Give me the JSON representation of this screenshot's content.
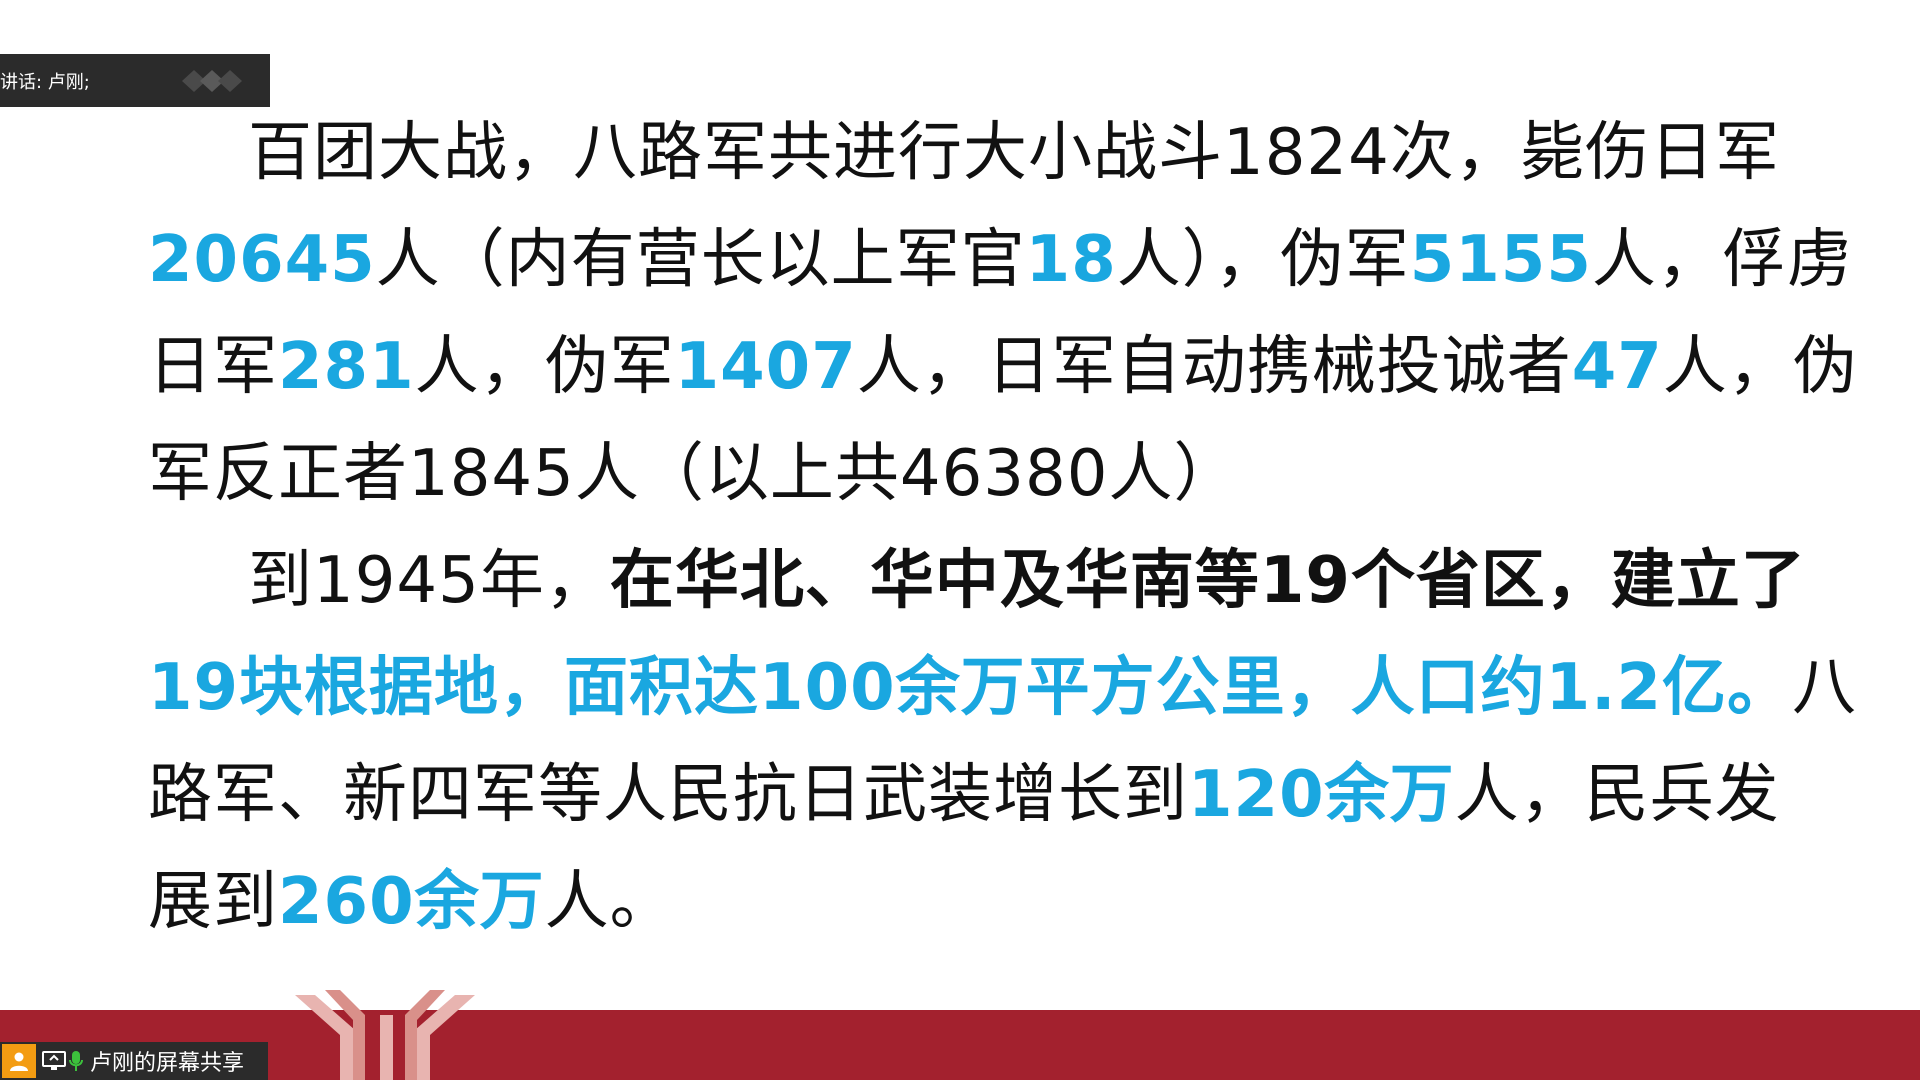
{
  "overlay": {
    "speaker_label": "讲话: 卢刚;",
    "share_label": "卢刚的屏幕共享"
  },
  "slide": {
    "para1": {
      "l1_a": "百团大战，八路军共进行大小战斗1824次，毙伤日军",
      "l2_n1": "20645",
      "l2_a": "人（内有营长以上军官",
      "l2_n2": "18",
      "l2_b": "人），伪军",
      "l2_n3": "5155",
      "l2_c": "人，俘虏",
      "l3_a": "日军",
      "l3_n1": "281",
      "l3_b": "人，伪军",
      "l3_n2": "1407",
      "l3_c": "人，日军自动携械投诚者",
      "l3_n3": "47",
      "l3_d": "人，伪",
      "l4_a": "军反正者1845人（以上共46380人）"
    },
    "para2": {
      "l5_a": "到1945年，",
      "l5_b": "在华北、华中及华南等",
      "l5_n1": "19",
      "l5_c": "个省区，建立了",
      "l6_hl": "19块根据地，面积达100余万平方公里，人口约1.2亿。",
      "l6_a": "八",
      "l7_a": "路军、新四军等人民抗日武装增长到",
      "l7_n1": "120",
      "l7_hl": "余万",
      "l7_b": "人，民兵发",
      "l8_a": "展到",
      "l8_n1": "260",
      "l8_hl": "余万",
      "l8_b": "人。"
    }
  },
  "colors": {
    "highlight": "#1aa7e0",
    "footer_band": "#a3212e",
    "overlay_bg": "#2b2b2b"
  }
}
